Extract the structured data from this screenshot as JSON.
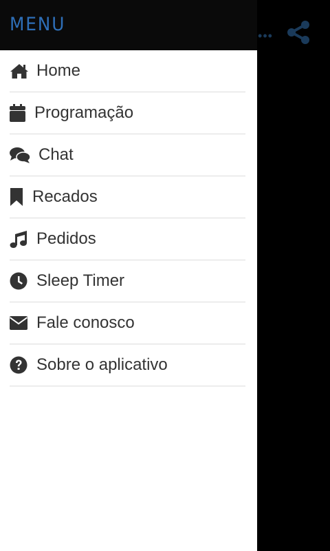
{
  "drawer": {
    "title": "MENU",
    "items": [
      {
        "id": "home",
        "label": "Home",
        "icon": "home-icon"
      },
      {
        "id": "programacao",
        "label": "Programação",
        "icon": "calendar-icon"
      },
      {
        "id": "chat",
        "label": "Chat",
        "icon": "chat-bubbles-icon"
      },
      {
        "id": "recados",
        "label": "Recados",
        "icon": "bookmark-icon"
      },
      {
        "id": "pedidos",
        "label": "Pedidos",
        "icon": "music-note-icon"
      },
      {
        "id": "sleep-timer",
        "label": "Sleep Timer",
        "icon": "clock-icon"
      },
      {
        "id": "fale-conosco",
        "label": "Fale conosco",
        "icon": "envelope-icon"
      },
      {
        "id": "sobre",
        "label": "Sobre o aplicativo",
        "icon": "question-circle-icon"
      }
    ]
  },
  "background_app": {
    "overflow_icon": "more-dots-icon",
    "share_icon": "share-icon"
  },
  "colors": {
    "drawer_header_bg": "#0a0a0a",
    "title_color": "#2e6fb8",
    "item_text": "#333333",
    "divider": "#dcdcdc",
    "share_icon_color": "#1a3a5a"
  }
}
